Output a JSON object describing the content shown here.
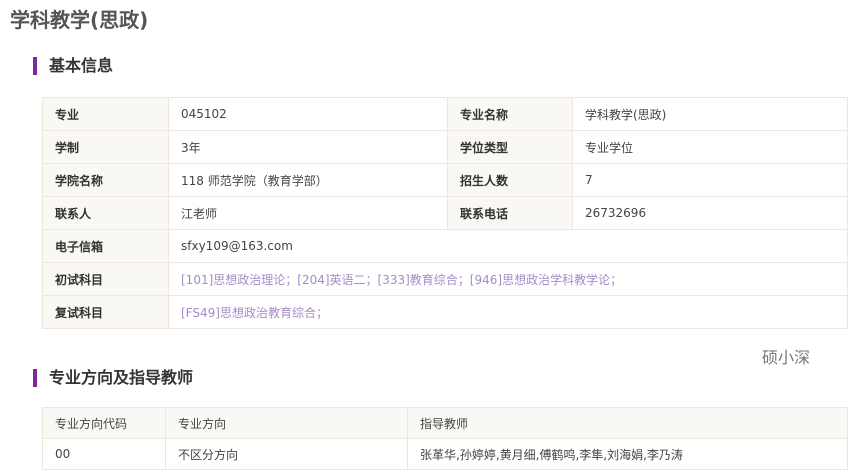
{
  "title": "学科教学(思政)",
  "basic": {
    "heading": "基本信息",
    "rows": [
      [
        "专业",
        "045102",
        "专业名称",
        "学科教学(思政)"
      ],
      [
        "学制",
        "3年",
        "学位类型",
        "专业学位"
      ],
      [
        "学院名称",
        "118 师范学院（教育学部）",
        "招生人数",
        "7"
      ],
      [
        "联系人",
        "江老师",
        "联系电话",
        "26732696"
      ]
    ],
    "email_label": "电子信箱",
    "email": "sfxy109@163.com",
    "exam1_label": "初试科目",
    "exam1": "[101]思想政治理论；[204]英语二；[333]教育综合；[946]思想政治学科教学论；",
    "exam2_label": "复试科目",
    "exam2": "[FS49]思想政治教育综合；"
  },
  "watermark": "硕小深",
  "directions": {
    "heading": "专业方向及指导教师",
    "headers": [
      "专业方向代码",
      "专业方向",
      "指导教师"
    ],
    "rows": [
      [
        "00",
        "不区分方向",
        "张革华,孙婷婷,黄月细,傅鹤鸣,李隼,刘海娟,李乃涛"
      ]
    ]
  }
}
